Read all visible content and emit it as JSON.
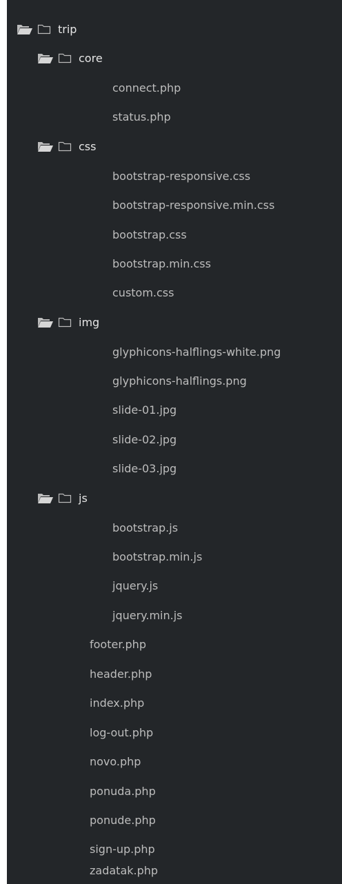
{
  "tree": {
    "root": {
      "name": "trip",
      "icons": [
        "folder-open-icon",
        "folder-icon"
      ]
    },
    "folders": [
      {
        "name": "core",
        "files": [
          "connect.php",
          "status.php"
        ]
      },
      {
        "name": "css",
        "files": [
          "bootstrap-responsive.css",
          "bootstrap-responsive.min.css",
          "bootstrap.css",
          "bootstrap.min.css",
          "custom.css"
        ]
      },
      {
        "name": "img",
        "files": [
          "glyphicons-halflings-white.png",
          "glyphicons-halflings.png",
          "slide-01.jpg",
          "slide-02.jpg",
          "slide-03.jpg"
        ]
      },
      {
        "name": "js",
        "files": [
          "bootstrap.js",
          "bootstrap.min.js",
          "jquery.js",
          "jquery.min.js"
        ]
      }
    ],
    "root_files": [
      "footer.php",
      "header.php",
      "index.php",
      "log-out.php",
      "novo.php",
      "ponuda.php",
      "ponude.php",
      "sign-up.php",
      "zadatak.php"
    ]
  },
  "colors": {
    "background": "#232629",
    "folder_text": "#e6e6e6",
    "file_text": "#bdbdbd",
    "icon": "#bcbcbc"
  }
}
